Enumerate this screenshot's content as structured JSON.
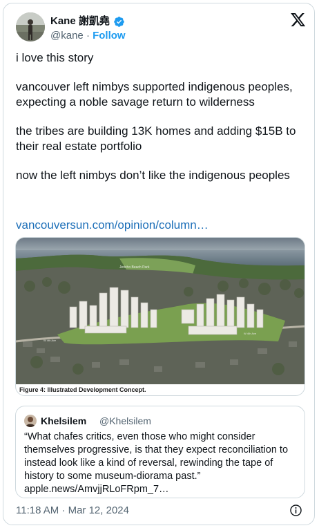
{
  "author": {
    "name": "Kane 謝凱堯",
    "handle": "@kane",
    "separator": "·",
    "follow_label": "Follow",
    "verified_color": "#1d9bf0"
  },
  "icons": {
    "brand": "x-logo-icon",
    "verified": "verified-badge-icon",
    "info": "info-icon"
  },
  "tweet": {
    "paragraphs": [
      "i love this story",
      "vancouver left nimbys supported indigenous peoples, expecting a noble savage return to wilderness",
      "the tribes are building 13K homes and adding $15B to their real estate portfolio",
      "now the left nimbys don’t like the indigenous peoples"
    ],
    "link": "vancouversun.com/opinion/column…"
  },
  "media": {
    "caption": "Figure 4: Illustrated Development Concept.",
    "map_labels": {
      "beach_park": "Jericho Beach Park",
      "road_west": "W 4th Ave",
      "road_east": "W 4th Ave"
    }
  },
  "quote": {
    "name": "Khelsilem",
    "handle": "@Khelsilem",
    "text": "“What chafes critics, even those who might consider themselves progressive, is that they expect reconciliation to instead look like a kind of reversal, rewinding the tape of history to some museum-diorama past.”",
    "link": "apple.news/AmvjjRLoFRpm_7…"
  },
  "footer": {
    "timestamp": "11:18 AM · Mar 12, 2024"
  },
  "colors": {
    "link": "#1d6fb8",
    "muted": "#536471",
    "border": "#cfd9de",
    "accent": "#1d9bf0"
  }
}
